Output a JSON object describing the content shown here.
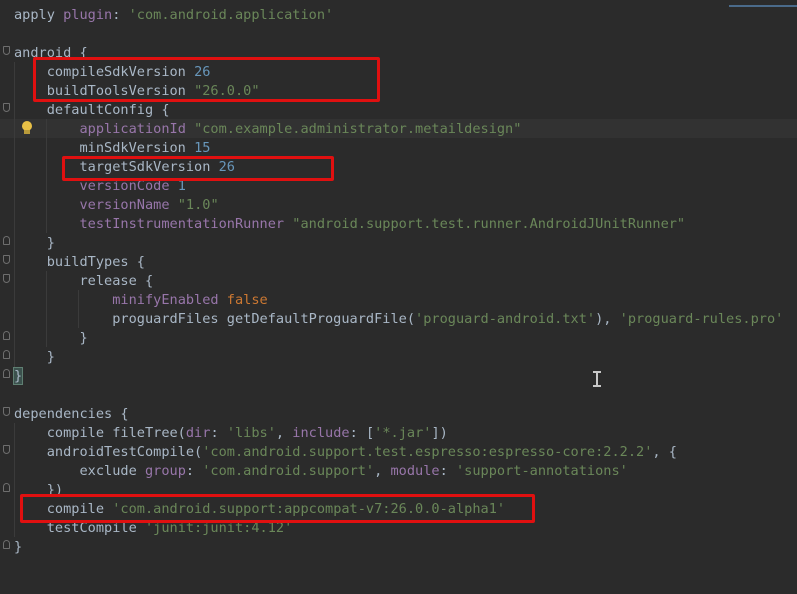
{
  "editor": {
    "highlight_color": "#e01010",
    "colors": {
      "background": "#2b2b2b",
      "text": "#a9b7c6",
      "keyword": "#cc7832",
      "number": "#6897bb",
      "string": "#6a8759",
      "gradle_property": "#9876aa"
    },
    "lines": [
      {
        "segments": [
          [
            "plain",
            "apply "
          ],
          [
            "purple",
            "plugin"
          ],
          [
            "plain",
            ": "
          ],
          [
            "str",
            "'com.android.application'"
          ]
        ]
      },
      {
        "segments": []
      },
      {
        "segments": [
          [
            "plain",
            "android {"
          ]
        ]
      },
      {
        "segments": [
          [
            "plain",
            "    compileSdkVersion "
          ],
          [
            "num",
            "26"
          ]
        ]
      },
      {
        "segments": [
          [
            "plain",
            "    buildToolsVersion "
          ],
          [
            "str",
            "\"26.0.0\""
          ]
        ]
      },
      {
        "segments": [
          [
            "plain",
            "    defaultConfig {"
          ]
        ]
      },
      {
        "segments": [
          [
            "plain",
            "        "
          ],
          [
            "purple",
            "applicationId "
          ],
          [
            "str",
            "\"com.example.administrator.metaildesign\""
          ]
        ]
      },
      {
        "segments": [
          [
            "plain",
            "        minSdkVersion "
          ],
          [
            "num",
            "15"
          ]
        ]
      },
      {
        "segments": [
          [
            "plain",
            "        targetSdkVersion "
          ],
          [
            "num",
            "26"
          ]
        ]
      },
      {
        "segments": [
          [
            "plain",
            "        "
          ],
          [
            "purple",
            "versionCode "
          ],
          [
            "num",
            "1"
          ]
        ]
      },
      {
        "segments": [
          [
            "plain",
            "        "
          ],
          [
            "purple",
            "versionName "
          ],
          [
            "str",
            "\"1.0\""
          ]
        ]
      },
      {
        "segments": [
          [
            "plain",
            "        "
          ],
          [
            "purple",
            "testInstrumentationRunner "
          ],
          [
            "str",
            "\"android.support.test.runner.AndroidJUnitRunner\""
          ]
        ]
      },
      {
        "segments": [
          [
            "plain",
            "    }"
          ]
        ]
      },
      {
        "segments": [
          [
            "plain",
            "    buildTypes {"
          ]
        ]
      },
      {
        "segments": [
          [
            "plain",
            "        release {"
          ]
        ]
      },
      {
        "segments": [
          [
            "plain",
            "            "
          ],
          [
            "purple",
            "minifyEnabled "
          ],
          [
            "kw",
            "false"
          ]
        ]
      },
      {
        "segments": [
          [
            "plain",
            "            proguardFiles getDefaultProguardFile("
          ],
          [
            "str",
            "'proguard-android.txt'"
          ],
          [
            "plain",
            "), "
          ],
          [
            "str",
            "'proguard-rules.pro'"
          ]
        ]
      },
      {
        "segments": [
          [
            "plain",
            "        }"
          ]
        ]
      },
      {
        "segments": [
          [
            "plain",
            "    }"
          ]
        ]
      },
      {
        "segments": [
          [
            "match",
            "}"
          ]
        ]
      },
      {
        "segments": []
      },
      {
        "segments": [
          [
            "plain",
            "dependencies {"
          ]
        ]
      },
      {
        "segments": [
          [
            "plain",
            "    compile fileTree("
          ],
          [
            "purple",
            "dir"
          ],
          [
            "plain",
            ": "
          ],
          [
            "str",
            "'libs'"
          ],
          [
            "plain",
            ", "
          ],
          [
            "purple",
            "include"
          ],
          [
            "plain",
            ": ["
          ],
          [
            "str",
            "'*.jar'"
          ],
          [
            "plain",
            "])"
          ]
        ]
      },
      {
        "segments": [
          [
            "plain",
            "    androidTestCompile("
          ],
          [
            "str",
            "'com.android.support.test.espresso:espresso-core:2.2.2'"
          ],
          [
            "plain",
            ", {"
          ]
        ]
      },
      {
        "segments": [
          [
            "plain",
            "        exclude "
          ],
          [
            "purple",
            "group"
          ],
          [
            "plain",
            ": "
          ],
          [
            "str",
            "'com.android.support'"
          ],
          [
            "plain",
            ", "
          ],
          [
            "purple",
            "module"
          ],
          [
            "plain",
            ": "
          ],
          [
            "str",
            "'support-annotations'"
          ]
        ]
      },
      {
        "segments": [
          [
            "plain",
            "    })"
          ]
        ]
      },
      {
        "segments": [
          [
            "plain",
            "    compile "
          ],
          [
            "str",
            "'com.android.support:appcompat-v7:26.0.0-alpha1'"
          ]
        ]
      },
      {
        "segments": [
          [
            "plain",
            "    testCompile "
          ],
          [
            "str",
            "'junit:junit:4.12'"
          ]
        ]
      },
      {
        "segments": [
          [
            "plain",
            "}"
          ]
        ]
      }
    ]
  }
}
